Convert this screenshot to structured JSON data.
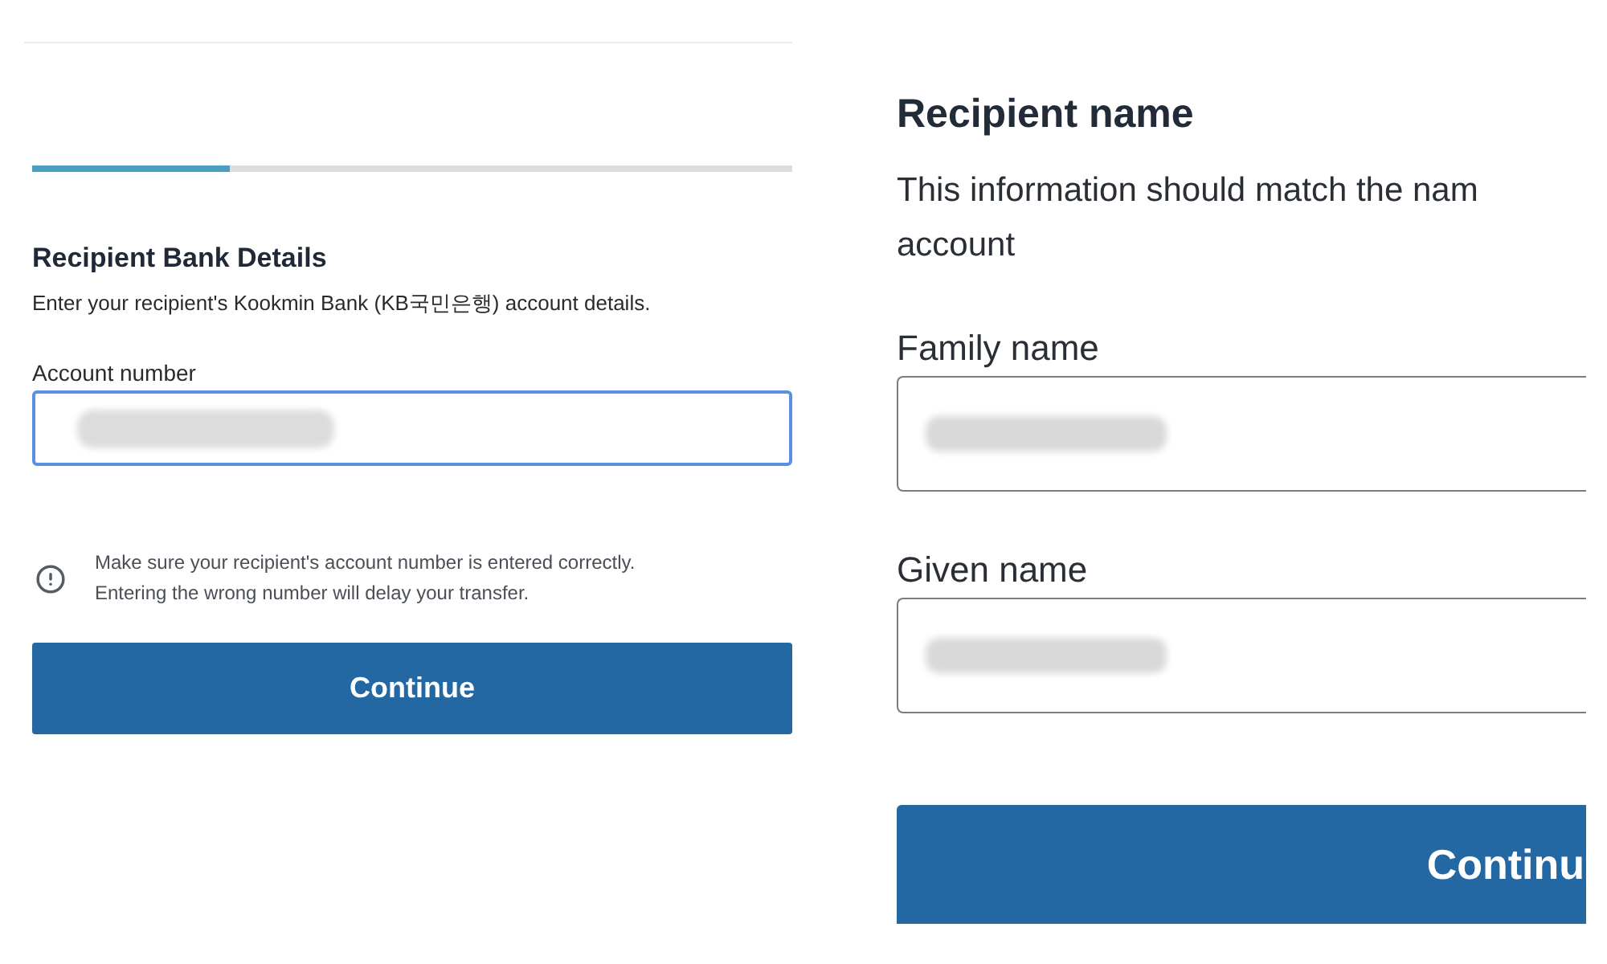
{
  "progress": {
    "level": 0.26
  },
  "bank_details": {
    "title": "Recipient Bank Details",
    "description": "Enter your recipient's Kookmin Bank (KB국민은행) account details.",
    "field": {
      "label": "Account number",
      "focused": true,
      "redacted": true
    },
    "notice": "Make sure your recipient's account number is entered correctly.\nEntering the wrong number will delay your transfer.",
    "button": "Continue"
  },
  "recipient_name": {
    "title": "Recipient name",
    "description": "This information should match the nam\naccount",
    "fields": [
      {
        "label": "Family name",
        "focused": false,
        "redacted": true
      },
      {
        "label": "Given name",
        "focused": false,
        "redacted": true
      }
    ],
    "button": "Continu"
  }
}
